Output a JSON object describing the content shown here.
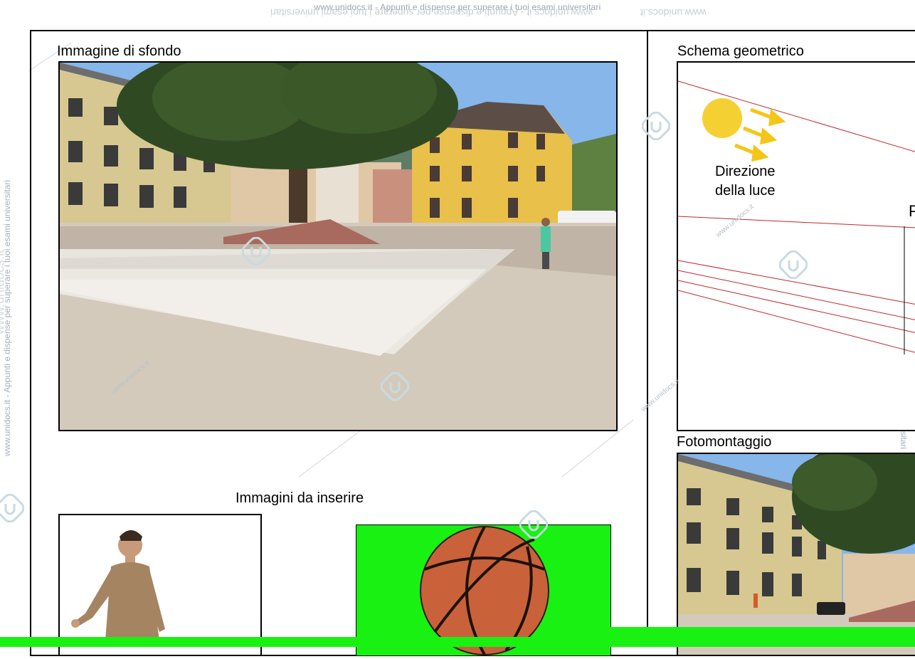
{
  "watermark": {
    "top_text": "www.unidocs.it - Appunti e dispense per superare i tuoi esami universitari",
    "mirror_text": "www.unidocs.it - Appunti e dispense per superare i tuoi esami universitari",
    "mirror_text_short": "www.unidocs.it",
    "side_text": "www.unidocs.it - Appunti e dispense per superare i tuoi esami universitari",
    "side_text_large": "www.unidocs.it",
    "diag_text": "www.unidocs.it"
  },
  "sections": {
    "background_title": "Immagine di sfondo",
    "schema_title": "Schema geometrico",
    "insert_title": "Immagini da inserire",
    "montage_title": "Fotomontaggio"
  },
  "schema": {
    "light_label_line1": "Direzione",
    "light_label_line2": "della luce",
    "cut_letter": "P",
    "sun_color": "#f5d033",
    "arrow_color": "#f5c518",
    "ray_color": "#c0272d"
  },
  "colors": {
    "chroma_green": "#19f113",
    "sky": "#7fb2e8",
    "building": "#d8c98a",
    "pavement": "#d8cfc1"
  },
  "icons": {
    "watermark_logo": "unidocs-logo-icon",
    "sun": "sun-icon",
    "arrow": "arrow-icon"
  }
}
